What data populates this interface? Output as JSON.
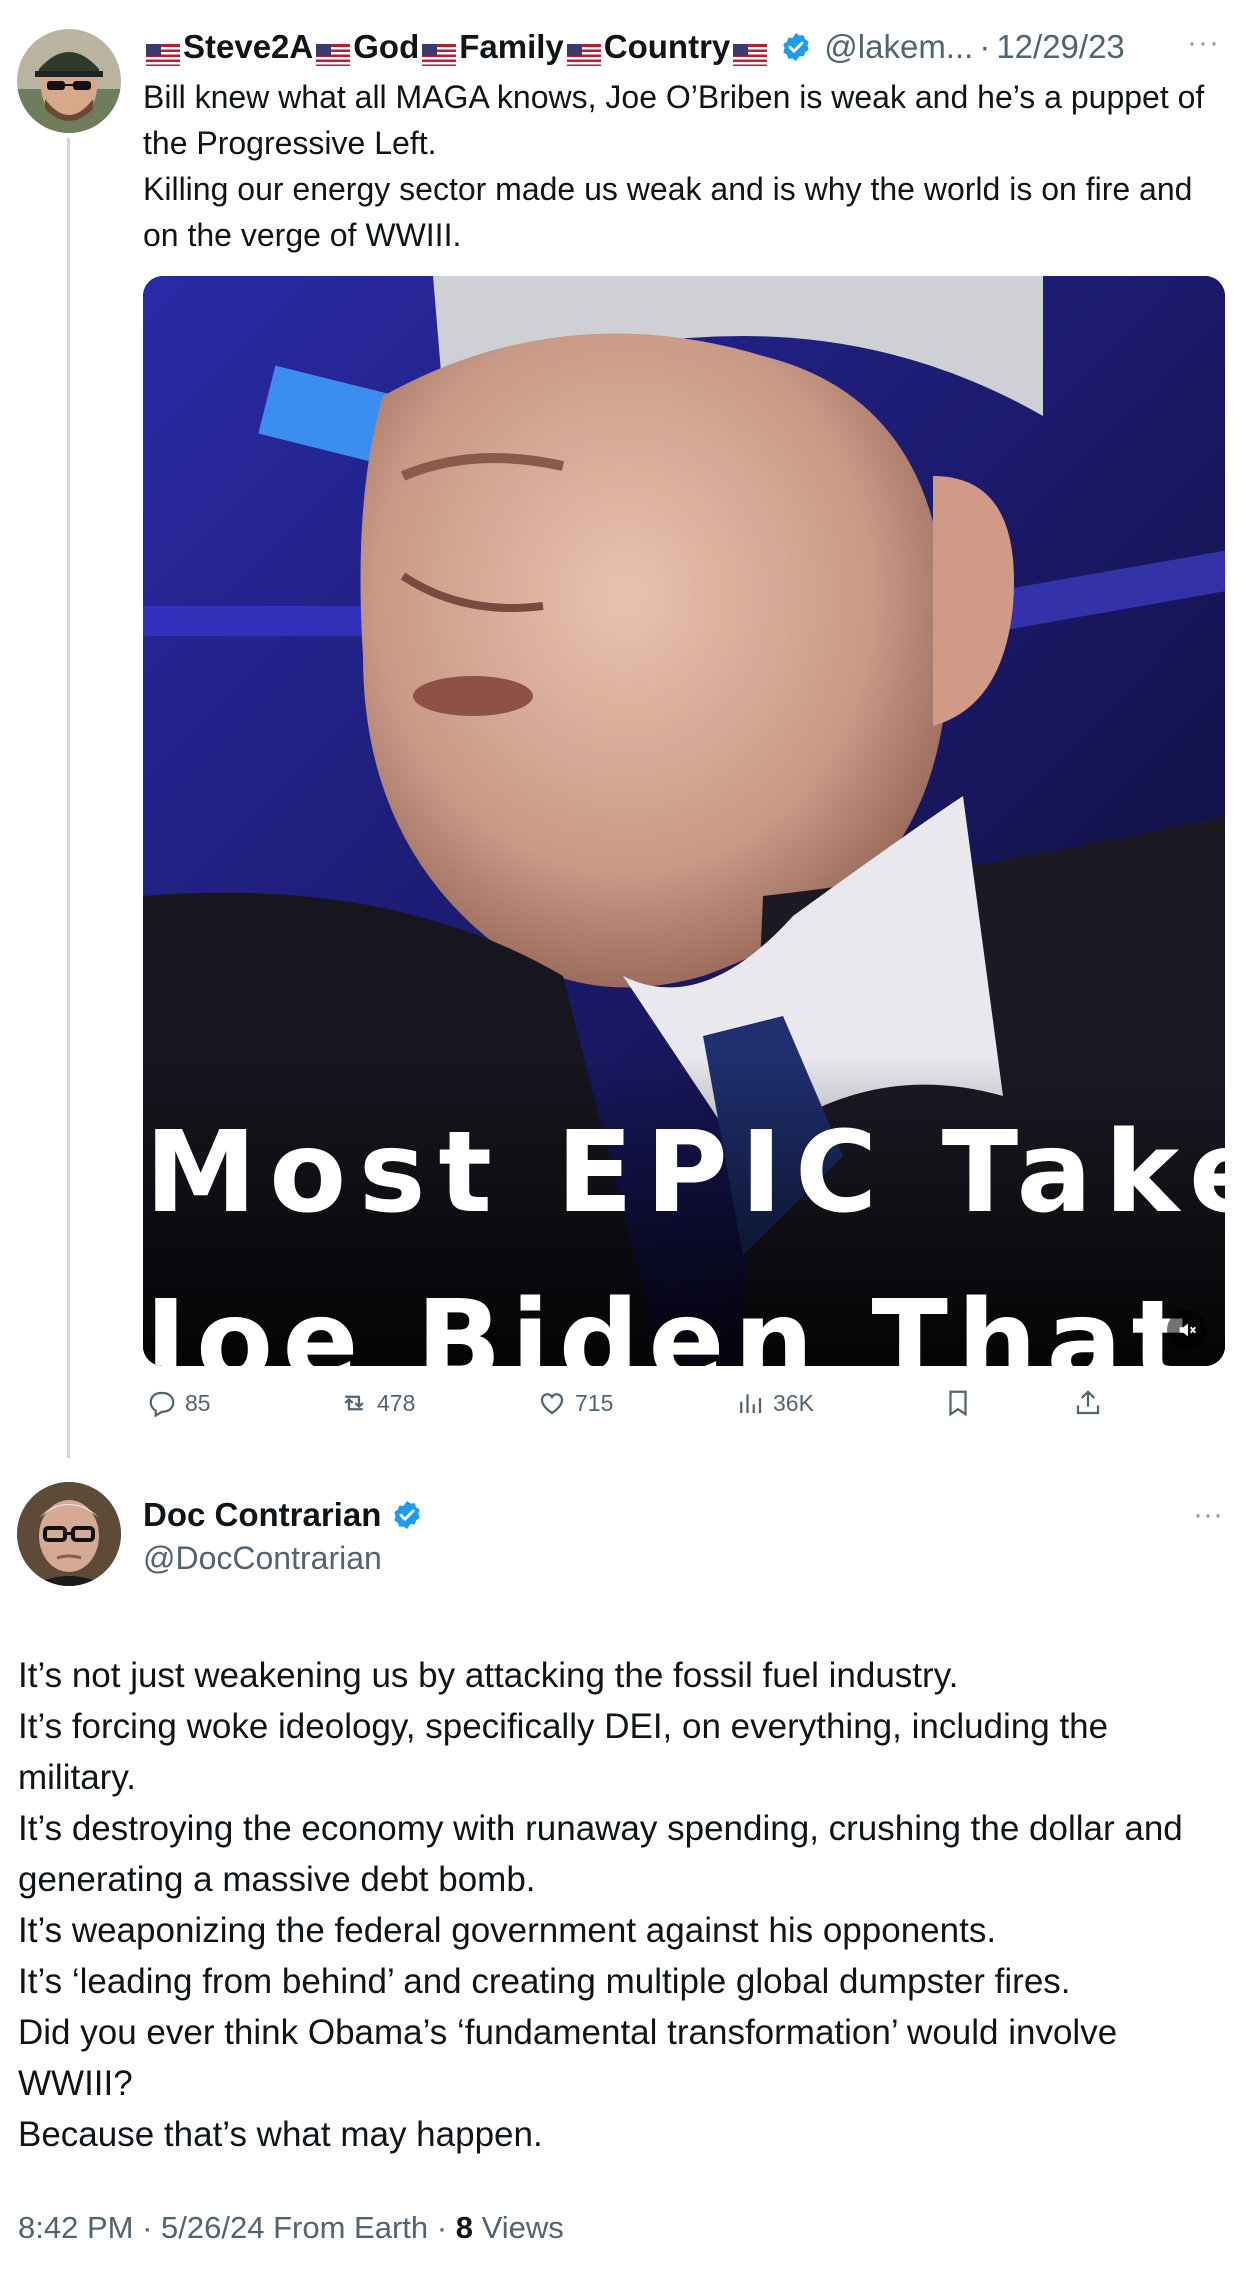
{
  "tweet1": {
    "display_name": "Steve2A",
    "name_parts": [
      "God",
      "Family",
      "Country"
    ],
    "handle": "@lakem...",
    "separator": "·",
    "date": "12/29/23",
    "more": "···",
    "text_lines": [
      "Bill knew what all MAGA knows, Joe O’Briben is weak and he’s a puppet of the Progressive Left.",
      "Killing our energy sector made us  weak and is why the world is on fire and on the verge of WWIII."
    ],
    "media": {
      "caption_line1": "Most EPIC Take",
      "caption_line2": "Joe Biden That"
    },
    "actions": {
      "replies": "85",
      "reposts": "478",
      "likes": "715",
      "views": "36K"
    }
  },
  "tweet2": {
    "display_name": "Doc Contrarian",
    "handle": "@DocContrarian",
    "more": "···",
    "text_lines": [
      "It’s not just weakening us by attacking the fossil fuel industry.",
      "It’s forcing woke ideology, specifically DEI, on everything, including the military.",
      "It’s destroying the economy with runaway spending, crushing the dollar and generating a massive debt bomb.",
      "It’s weaponizing the federal government against his opponents.",
      "It’s ‘leading from behind’ and creating multiple global dumpster fires.",
      "Did you ever think Obama’s ‘fundamental transformation’ would involve WWIII?",
      "Because that’s what may happen."
    ],
    "time": "8:42 PM",
    "date": "5/26/24",
    "source": "From Earth",
    "separator": "·",
    "views_count": "8",
    "views_label": "Views"
  },
  "colors": {
    "text": "#0f1419",
    "secondary": "#536471",
    "verified": "#1d9bf0",
    "thread_line": "#cfd9de"
  }
}
